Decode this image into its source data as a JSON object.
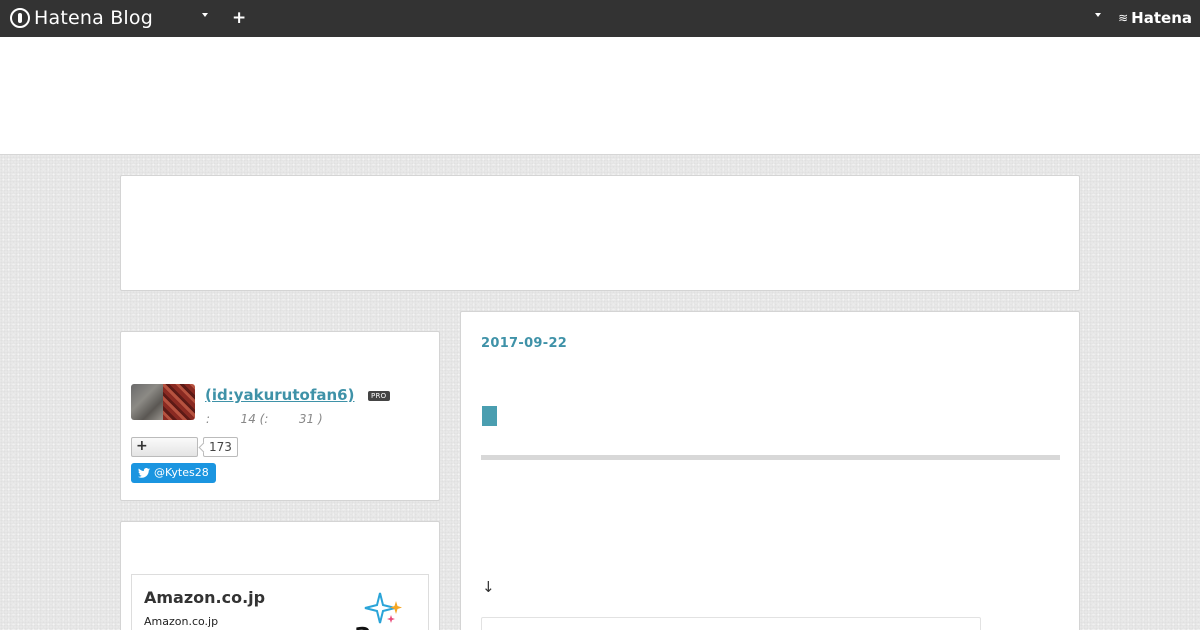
{
  "topbar": {
    "logo_text": "Hatena Blog",
    "add_label": "+",
    "brand_text": "Hatena",
    "colors": {
      "bar": "#333333",
      "text": "#ffffff"
    }
  },
  "profile": {
    "name": " (id:yakurutofan6)",
    "badge": "PRO",
    "meta": ":        14 (:        31 )",
    "follow_label": "+",
    "follow_count": "173",
    "twitter_label": "@Kytes28"
  },
  "amazon": {
    "title": "Amazon.co.jp",
    "subtitle": "Amazon.co.jp"
  },
  "article": {
    "date": "2017-09-22",
    "arrow": "↓"
  },
  "colors": {
    "accent": "#3f92a8",
    "twitter": "#1b95e0"
  }
}
